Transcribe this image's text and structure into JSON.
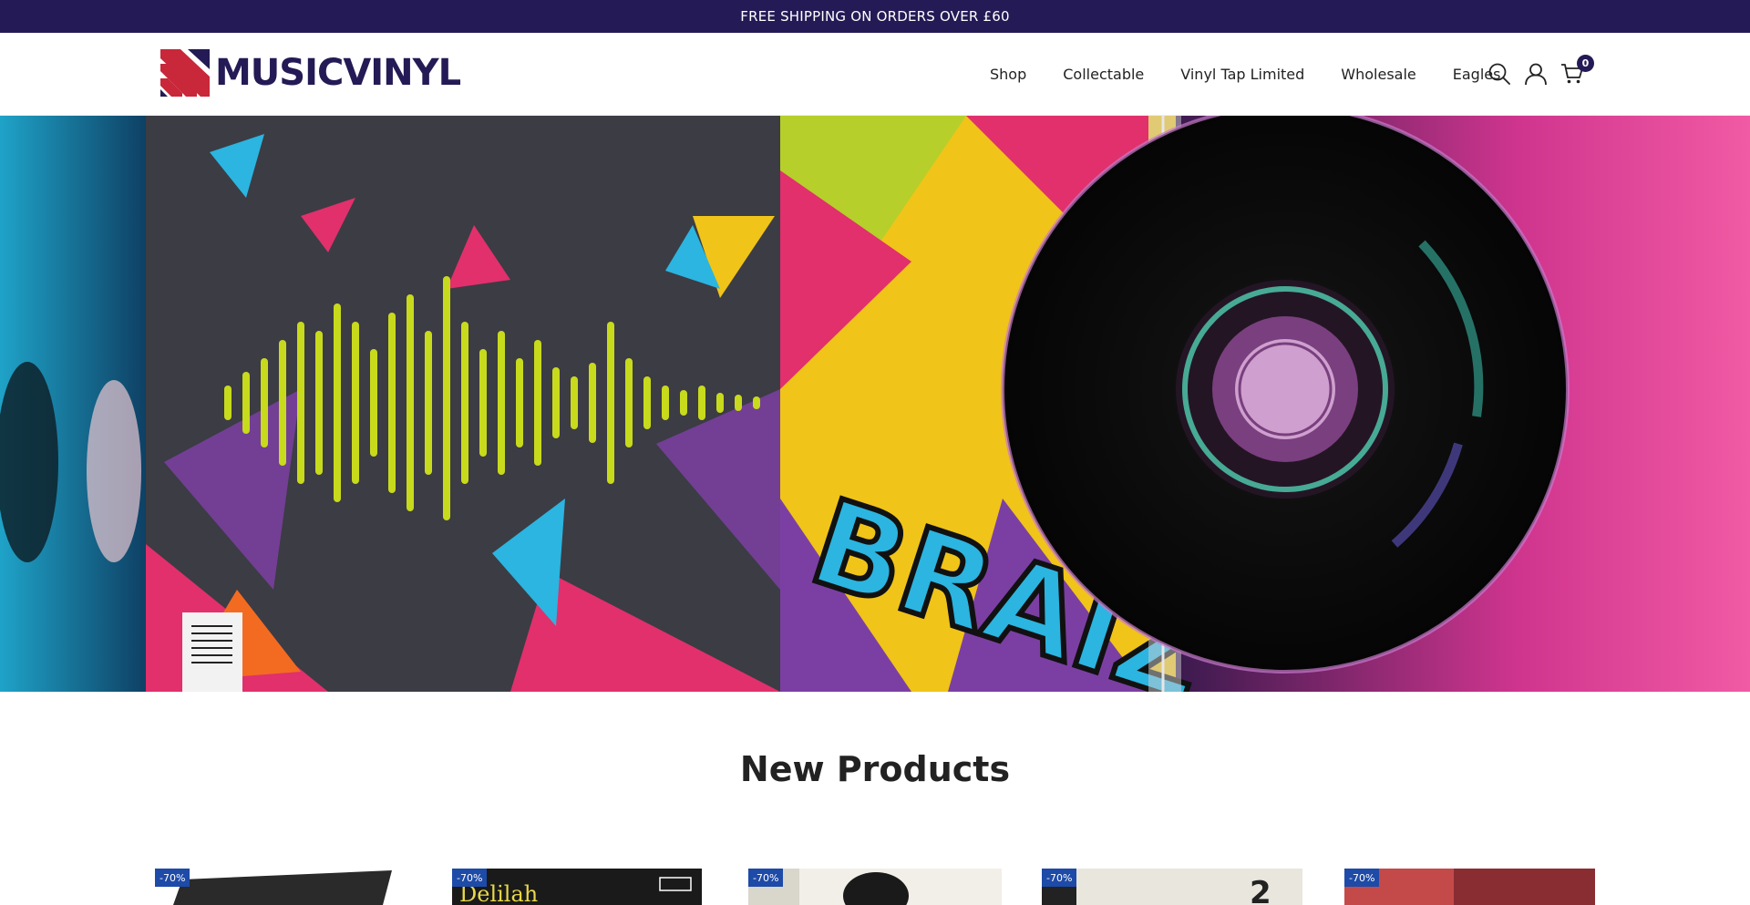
{
  "announcement": {
    "text": "FREE SHIPPING ON ORDERS OVER £60"
  },
  "header": {
    "logo_text": "MUSICVINYL",
    "nav": [
      {
        "label": "Shop"
      },
      {
        "label": "Collectable"
      },
      {
        "label": "Vinyl Tap Limited"
      },
      {
        "label": "Wholesale"
      },
      {
        "label": "Eagles"
      }
    ],
    "icons": {
      "search": "search-icon",
      "account": "user-icon",
      "cart": "cart-icon"
    },
    "cart_count": "0"
  },
  "hero": {
    "image": "graffiti-vinyl-album-banner"
  },
  "section": {
    "title": "New Products"
  },
  "products": [
    {
      "badge": "-70%"
    },
    {
      "badge": "-70%"
    },
    {
      "badge": "-70%"
    },
    {
      "badge": "-70%"
    },
    {
      "badge": "-70%"
    }
  ],
  "colors": {
    "brand": "#241a55",
    "logo_red": "#c8283a",
    "badge": "#1e4aa8"
  }
}
